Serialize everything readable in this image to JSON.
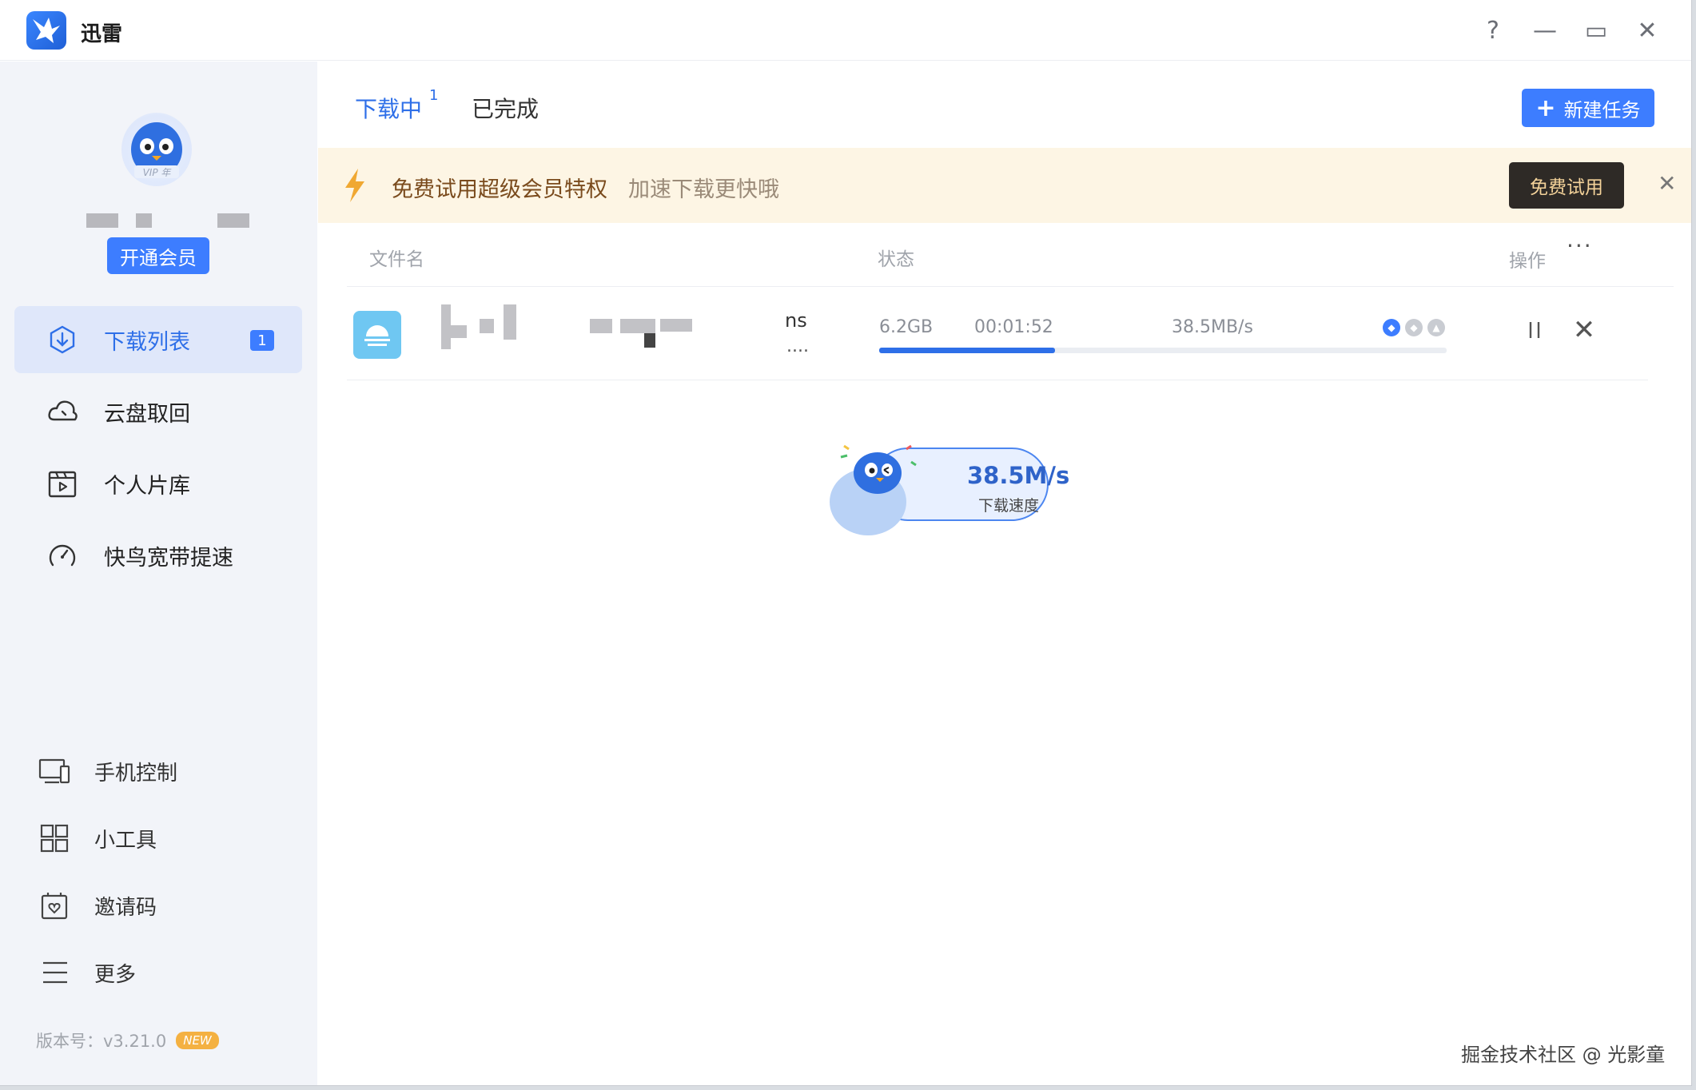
{
  "app": {
    "title": "迅雷"
  },
  "window_controls": {
    "help": "?",
    "minimize": "—",
    "maximize": "▭",
    "close": "✕"
  },
  "user": {
    "avatar_badge": "VIP 年",
    "open_vip_label": "开通会员"
  },
  "sidebar": {
    "nav": [
      {
        "label": "下载列表",
        "icon": "download-icon",
        "badge": "1",
        "active": true
      },
      {
        "label": "云盘取回",
        "icon": "cloud-icon"
      },
      {
        "label": "个人片库",
        "icon": "video-library-icon"
      },
      {
        "label": "快鸟宽带提速",
        "icon": "speedometer-icon"
      }
    ],
    "tools": [
      {
        "label": "手机控制",
        "icon": "devices-icon"
      },
      {
        "label": "小工具",
        "icon": "grid-icon"
      },
      {
        "label": "邀请码",
        "icon": "invite-icon"
      },
      {
        "label": "更多",
        "icon": "menu-icon"
      }
    ],
    "version_label": "版本号：v3.21.0",
    "new_badge": "NEW"
  },
  "main": {
    "tabs": {
      "downloading": "下载中",
      "downloading_count": "1",
      "completed": "已完成"
    },
    "new_task_label": "新建任务",
    "banner": {
      "title": "免费试用超级会员特权",
      "subtitle": "加速下载更快哦",
      "trial_label": "免费试用",
      "close": "✕"
    },
    "columns": {
      "name": "文件名",
      "status": "状态",
      "ops": "操作",
      "more": "···"
    },
    "task": {
      "name_tail": "ns",
      "name_ellipsis": "....",
      "size": "6.2GB",
      "elapsed": "00:01:52",
      "speed": "38.5MB/s",
      "progress": 0.31,
      "cancel": "✕"
    },
    "speed_widget": {
      "value": "38.5M/s",
      "label": "下载速度"
    }
  },
  "watermark": "掘金技术社区 @ 光影童",
  "colors": {
    "accent": "#3d7dff",
    "banner_bg": "#fdf5e4",
    "trial_btn": "#2e2a26"
  }
}
